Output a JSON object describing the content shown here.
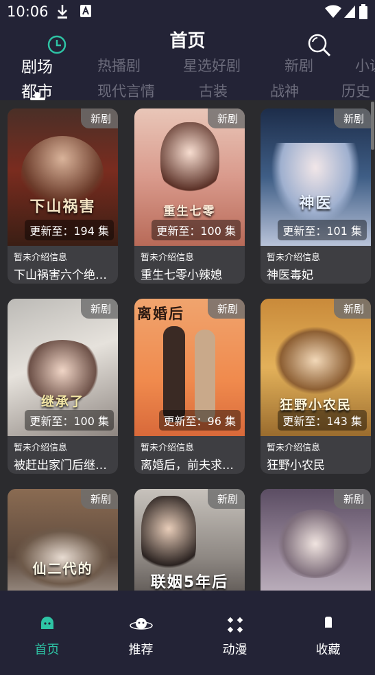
{
  "status": {
    "time": "10:06"
  },
  "header": {
    "title": "首页"
  },
  "tabs_row1": [
    {
      "label": "剧场",
      "active": true
    },
    {
      "label": "热播剧"
    },
    {
      "label": "星选好剧"
    },
    {
      "label": "新剧"
    },
    {
      "label": "小说"
    }
  ],
  "tabs_row2": [
    {
      "label": "都市",
      "active": true
    },
    {
      "label": "现代言情"
    },
    {
      "label": "古装"
    },
    {
      "label": "战神"
    },
    {
      "label": "历史"
    }
  ],
  "cards": [
    {
      "badge": "新剧",
      "poster_title": "下山祸害",
      "update": "更新至：194 集",
      "intro": "暂未介绍信息",
      "name": "下山祸害六个绝…"
    },
    {
      "badge": "新剧",
      "poster_title": "重生七零",
      "update": "更新至：100 集",
      "intro": "暂未介绍信息",
      "name": "重生七零小辣媳"
    },
    {
      "badge": "新剧",
      "poster_title": "神医",
      "update": "更新至：101 集",
      "intro": "暂未介绍信息",
      "name": "神医毒妃"
    },
    {
      "badge": "新剧",
      "poster_title": "继承了",
      "update": "更新至：100 集",
      "intro": "暂未介绍信息",
      "name": "被赶出家门后继…"
    },
    {
      "badge": "新剧",
      "poster_title": "离婚后",
      "update": "更新至：96 集",
      "intro": "暂未介绍信息",
      "name": "离婚后，前夫求…"
    },
    {
      "badge": "新剧",
      "poster_title": "狂野小农民",
      "update": "更新至：143 集",
      "intro": "暂未介绍信息",
      "name": "狂野小农民"
    },
    {
      "badge": "新剧",
      "poster_title": "仙二代的",
      "update": "",
      "intro": "",
      "name": ""
    },
    {
      "badge": "新剧",
      "poster_title": "联姻5年后",
      "update": "",
      "intro": "",
      "name": ""
    },
    {
      "badge": "新剧",
      "poster_title": "",
      "update": "",
      "intro": "",
      "name": ""
    }
  ],
  "nav": [
    {
      "label": "首页",
      "active": true,
      "icon": "home-ghost-icon"
    },
    {
      "label": "推荐",
      "icon": "planet-icon"
    },
    {
      "label": "动漫",
      "icon": "grid-icon"
    },
    {
      "label": "收藏",
      "icon": "bookmark-icon"
    }
  ],
  "colors": {
    "accent": "#2ec4a5",
    "header_bg": "#232336",
    "page_bg": "#2b2b2e",
    "card_bg": "#3e3e42"
  }
}
